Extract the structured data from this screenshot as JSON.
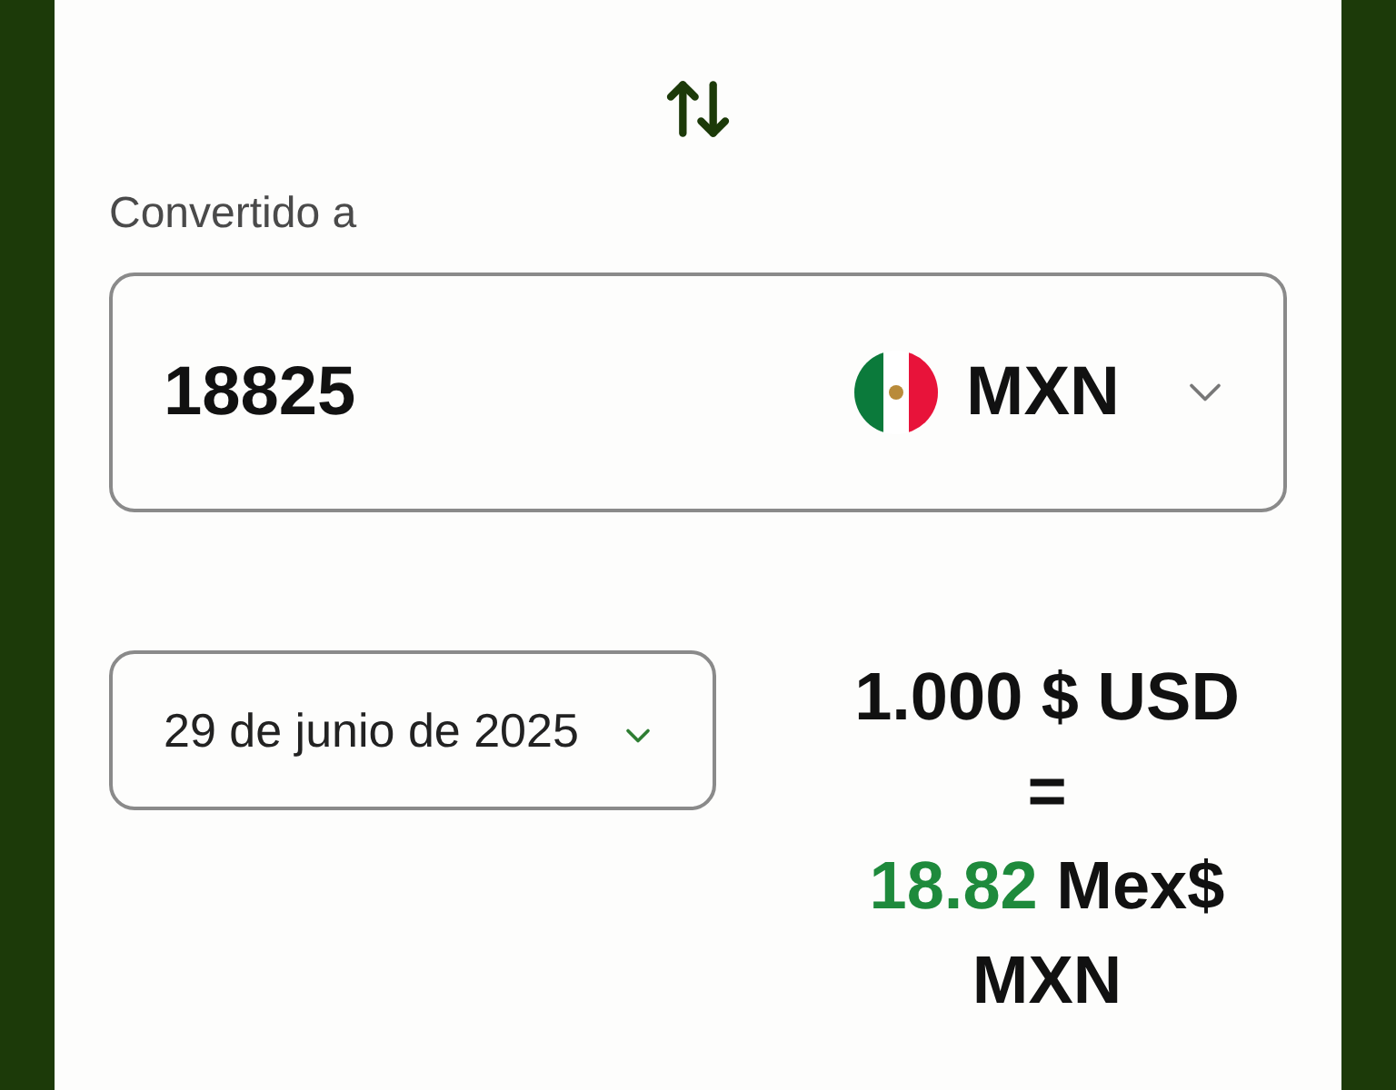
{
  "converted": {
    "label": "Convertido a",
    "amount": "18825",
    "currency": "MXN"
  },
  "date": {
    "value": "29 de junio de 2025"
  },
  "rate": {
    "from": "1.000 $ USD",
    "equals": "=",
    "to_amount": "18.82",
    "to_currency": "Mex$ MXN"
  }
}
